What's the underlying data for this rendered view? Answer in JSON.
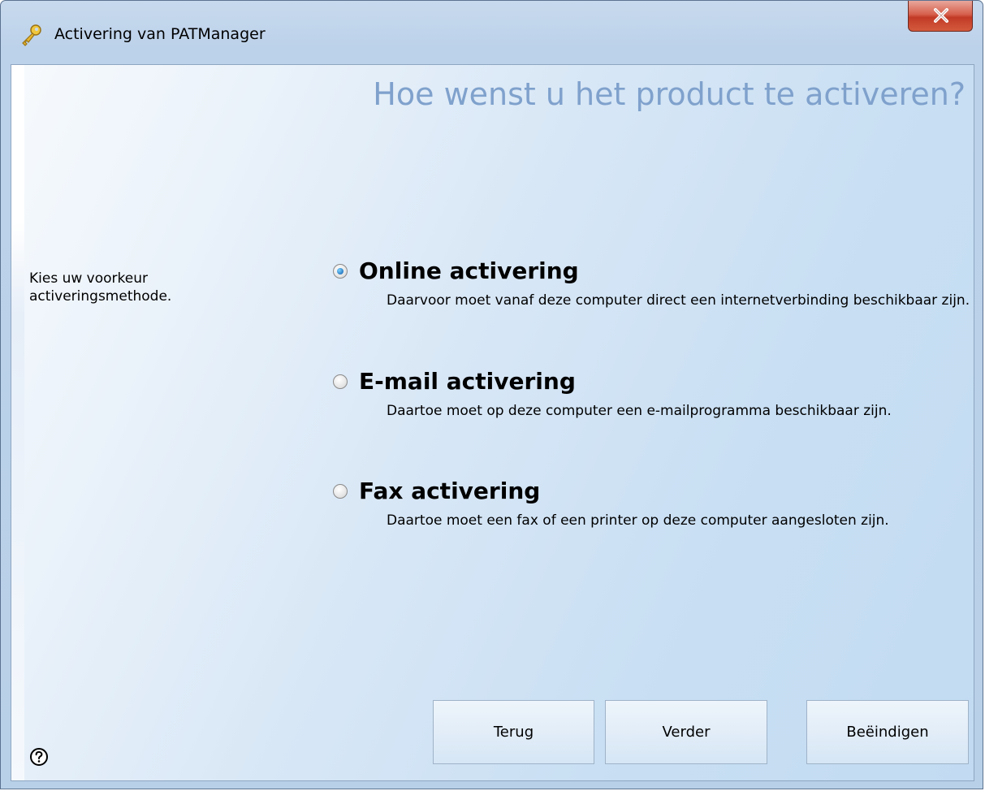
{
  "window": {
    "title": "Activering van PATManager",
    "close_icon": "close-icon",
    "title_icon": "key-icon"
  },
  "main": {
    "heading": "Hoe wenst u het product te activeren?",
    "instruction": "Kies uw voorkeur activeringsmethode.",
    "options": [
      {
        "label": "Online activering",
        "description": "Daarvoor moet vanaf deze computer direct een internetverbinding beschikbaar zijn.",
        "checked": true
      },
      {
        "label": "E-mail activering",
        "description": "Daartoe moet op deze computer een e-mailprogramma beschikbaar zijn.",
        "checked": false
      },
      {
        "label": "Fax activering",
        "description": "Daartoe moet een fax of een printer op deze computer aangesloten zijn.",
        "checked": false
      }
    ]
  },
  "buttons": {
    "back_label": "Terug",
    "next_label": "Verder",
    "finish_label": "Beëindigen"
  },
  "footer": {
    "help_icon": "help-icon"
  }
}
